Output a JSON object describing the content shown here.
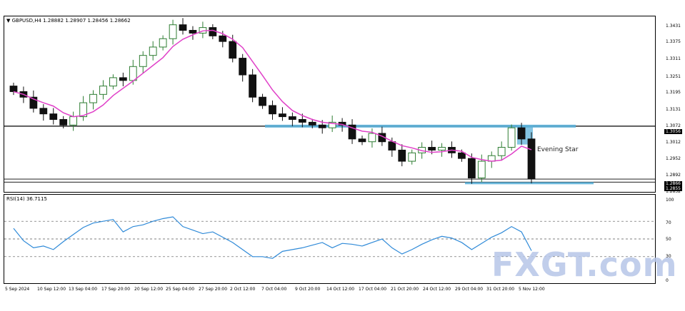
{
  "header": {
    "symbol_line": "▼ GBPUSD,H4  1.28882 1.28907 1.28456 1.28662"
  },
  "rsi": {
    "label": "RSI(14) 36.7115",
    "levels": [
      "100",
      "70",
      "50",
      "30",
      "0"
    ]
  },
  "price_axis": [
    "1.3431",
    "1.3375",
    "1.3311",
    "1.3251",
    "1.3195",
    "1.3131",
    "1.3072",
    "1.3012",
    "1.2952",
    "1.2892",
    "1.2832"
  ],
  "price_tags": {
    "resistance": "1.3056",
    "current_a": "1.2866",
    "current_b": "1.2855"
  },
  "time_axis": [
    "5 Sep 2024",
    "10 Sep 12:00",
    "13 Sep 04:00",
    "17 Sep 20:00",
    "20 Sep 12:00",
    "25 Sep 04:00",
    "27 Sep 20:00",
    "2 Oct 12:00",
    "7 Oct 04:00",
    "9 Oct 20:00",
    "14 Oct 12:00",
    "17 Oct 04:00",
    "21 Oct 20:00",
    "24 Oct 12:00",
    "29 Oct 04:00",
    "31 Oct 20:00",
    "5 Nov 12:00"
  ],
  "annotation": "Evening Star",
  "watermark": "FXGT.com",
  "colors": {
    "bull": "#2e7d32",
    "bear": "#111111",
    "ma": "#e040c8",
    "rsi": "#2f8ad8",
    "zone": "#5bb0d8"
  },
  "chart_data": {
    "type": "candlestick",
    "series": [
      {
        "name": "GBPUSD,H4",
        "close": [
          1.318,
          1.316,
          1.312,
          1.31,
          1.308,
          1.306,
          1.309,
          1.314,
          1.317,
          1.32,
          1.323,
          1.322,
          1.327,
          1.331,
          1.334,
          1.337,
          1.342,
          1.34,
          1.339,
          1.341,
          1.338,
          1.336,
          1.33,
          1.324,
          1.316,
          1.313,
          1.31,
          1.309,
          1.308,
          1.307,
          1.306,
          1.305,
          1.307,
          1.306,
          1.301,
          1.3,
          1.303,
          1.3,
          1.297,
          1.293,
          1.296,
          1.298,
          1.297,
          1.298,
          1.296,
          1.294,
          1.287,
          1.293,
          1.295,
          1.298,
          1.305,
          1.301,
          1.2866
        ]
      },
      {
        "name": "RSI(14)",
        "values": [
          62,
          48,
          40,
          42,
          38,
          47,
          55,
          63,
          68,
          70,
          72,
          58,
          64,
          66,
          70,
          73,
          75,
          64,
          60,
          56,
          58,
          52,
          46,
          38,
          30,
          30,
          28,
          36,
          38,
          40,
          43,
          46,
          40,
          45,
          44,
          42,
          46,
          50,
          40,
          33,
          38,
          44,
          49,
          53,
          51,
          46,
          38,
          45,
          52,
          57,
          64,
          58,
          36.7
        ]
      }
    ]
  }
}
